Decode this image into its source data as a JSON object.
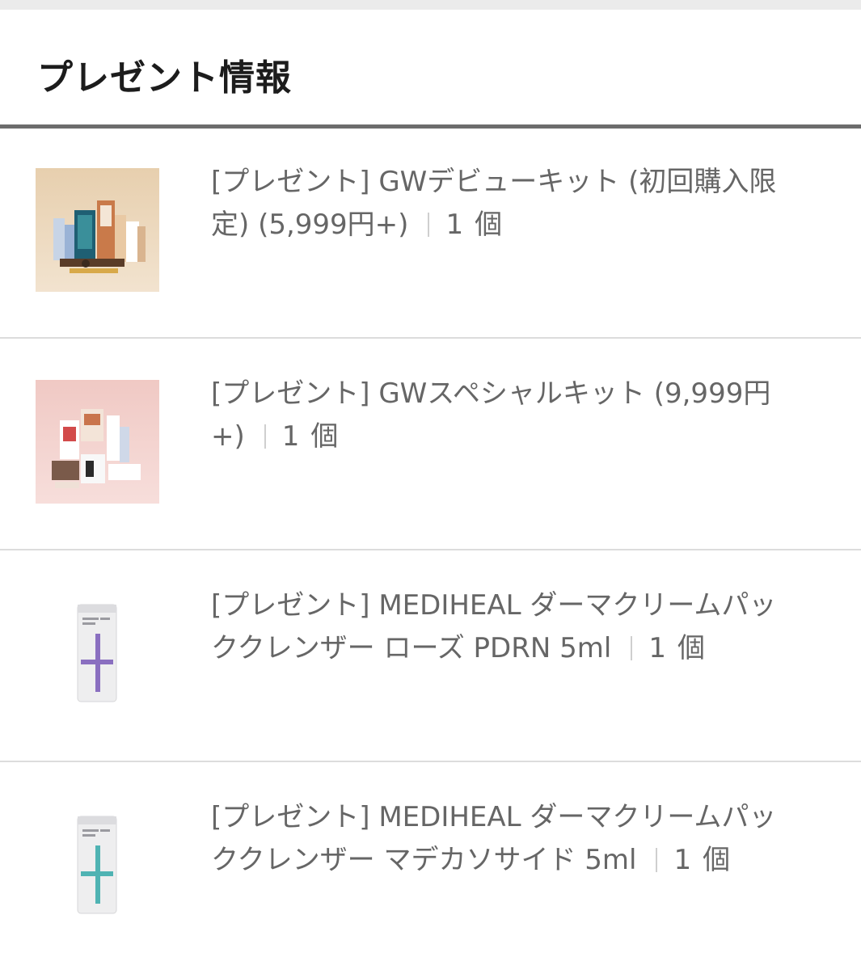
{
  "header": {
    "title": "プレゼント情報"
  },
  "items": [
    {
      "name": "[プレゼント] GWデビューキット (初回購入限定) (5,999円+)",
      "qty": "1",
      "unit": "個",
      "thumbnail_icon": "gift-kit-image"
    },
    {
      "name": "[プレゼント] GWスペシャルキット (9,999円+)",
      "qty": "1",
      "unit": "個",
      "thumbnail_icon": "gift-kit-image"
    },
    {
      "name": "[プレゼント] MEDIHEAL ダーマクリームパッククレンザー ローズ PDRN 5ml",
      "qty": "1",
      "unit": "個",
      "thumbnail_icon": "cleanser-tube-image",
      "accent_color": "#8a6fc0"
    },
    {
      "name": "[プレゼント] MEDIHEAL ダーマクリームパッククレンザー マデカソサイド 5ml",
      "qty": "1",
      "unit": "個",
      "thumbnail_icon": "cleanser-tube-image",
      "accent_color": "#4fb3b3"
    }
  ]
}
